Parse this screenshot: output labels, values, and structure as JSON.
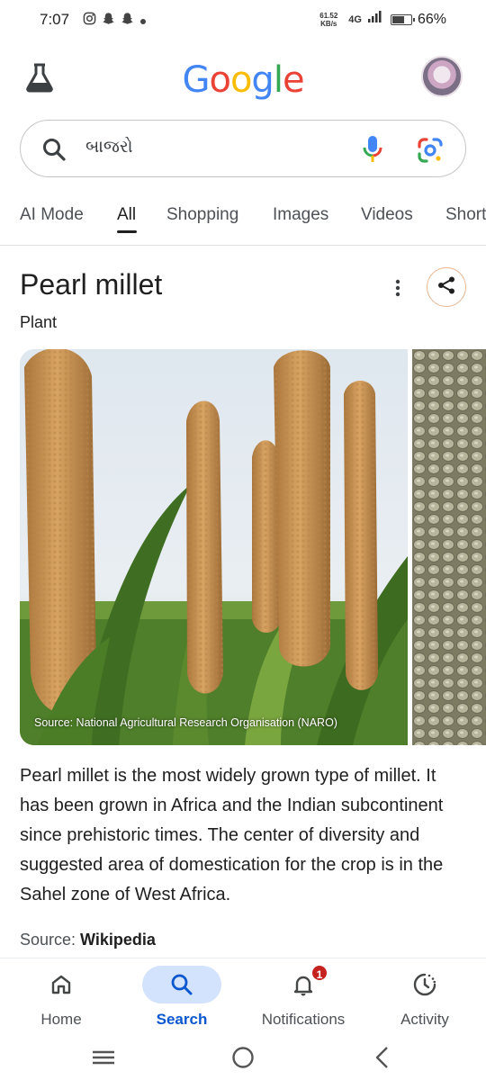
{
  "status_bar": {
    "time": "7:07",
    "net_speed_value": "61.52",
    "net_speed_unit": "KB/s",
    "network": "4G",
    "battery": "66%"
  },
  "header": {
    "logo_text": "Google",
    "logo_colors": [
      "#4285F4",
      "#EA4335",
      "#FBBC05",
      "#4285F4",
      "#34A853",
      "#EA4335"
    ]
  },
  "search": {
    "query": "બાજરો"
  },
  "tabs": [
    {
      "label": "AI Mode",
      "active": false
    },
    {
      "label": "All",
      "active": true
    },
    {
      "label": "Shopping",
      "active": false
    },
    {
      "label": "Images",
      "active": false
    },
    {
      "label": "Videos",
      "active": false
    },
    {
      "label": "Short",
      "active": false
    }
  ],
  "knowledge_panel": {
    "title": "Pearl millet",
    "subtitle": "Plant",
    "image_source": "Source: National Agricultural Research Organisation (NARO)",
    "description": "Pearl millet is the most widely grown type of millet. It has been grown in Africa and the Indian subcontinent since prehistoric times. The center of diversity and suggested area of domestication for the crop is in the Sahel zone of West Africa.",
    "source_label": "Source: ",
    "source_name": "Wikipedia"
  },
  "bottom_nav": {
    "items": [
      {
        "label": "Home",
        "icon": "home-icon",
        "active": false
      },
      {
        "label": "Search",
        "icon": "search-icon",
        "active": true
      },
      {
        "label": "Notifications",
        "icon": "bell-icon",
        "active": false,
        "badge": "1"
      },
      {
        "label": "Activity",
        "icon": "activity-icon",
        "active": false
      }
    ]
  },
  "colors": {
    "accent": "#0b57d0",
    "active_pill": "#d3e3fd",
    "badge": "#c5221f"
  }
}
